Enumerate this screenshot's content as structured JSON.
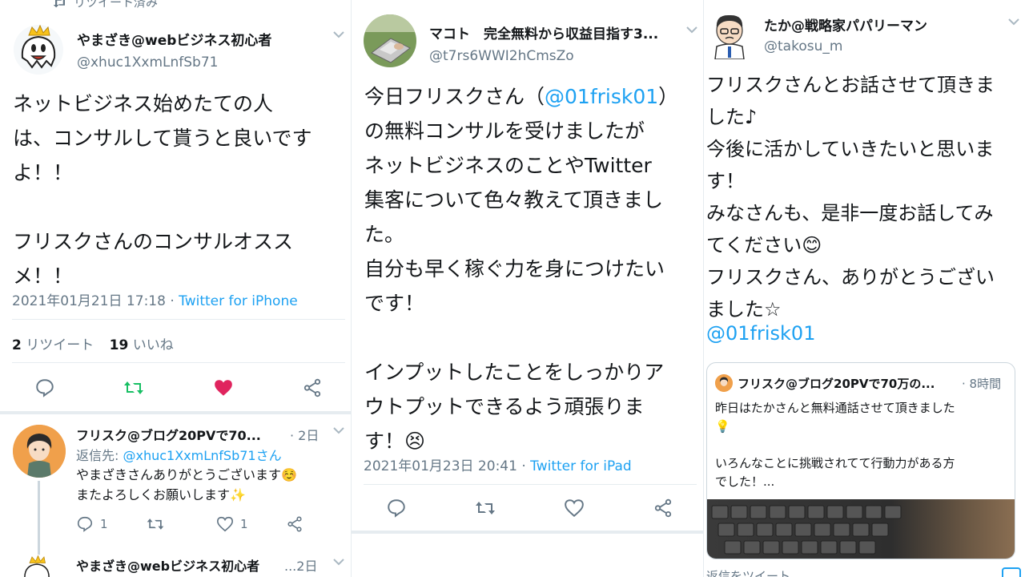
{
  "col1": {
    "retweeted_label": "リツイート済み",
    "author_name": "やまざき@webビジネス初心者",
    "author_handle": "@xhuc1XxmLnfSb71",
    "body": "ネットビジネス始めたての人\nは、コンサルして貰うと良いです\nよ！！\n\nフリスクさんのコンサルオスス\nメ！！",
    "timestamp": "2021年01月21日 17:18 · ",
    "source": "Twitter for iPhone",
    "retweet_count": "2",
    "retweet_label": "リツイート",
    "like_count": "19",
    "like_label": "いいね",
    "reply": {
      "author_name": "フリスク@ブログ20PVで70...",
      "time": "· 2日",
      "reply_to_label": "返信先: ",
      "reply_to_handle": "@xhuc1XxmLnfSb71さん",
      "text": "やまざきさんありがとうございます☺️\nまたよろしくお願いします✨",
      "reply_count": "1",
      "like_count": "1"
    },
    "next_reply": {
      "author_name": "やまざき@webビジネス初心者",
      "time": "...2日"
    }
  },
  "col2": {
    "author_name": "マコト　完全無料から収益目指す3...",
    "author_handle": "@t7rs6WWI2hCmsZo",
    "body_prefix": "今日フリスクさん（",
    "mention": "@01frisk01",
    "body_suffix": "）\nの無料コンサルを受けましたが\nネットビジネスのことやTwitter\n集客について色々教えて頂きまし\nた。\n自分も早く稼ぐ力を身につけたい\nです！\n\nインプットしたことをしっかりア\nウトプットできるよう頑張りま\nす！😣",
    "timestamp": "2021年01月23日 20:41 · ",
    "source": "Twitter for iPad"
  },
  "col3": {
    "author_name": "たか@戦略家パパリーマン",
    "author_handle": "@takosu_m",
    "body": "フリスクさんとお話させて頂きま\nした♪\n今後に活かしていきたいと思いま\nす！\nみなさんも、是非一度お話してみ\nてください😊\nフリスクさん、ありがとうござい\nました☆",
    "mention": "@01frisk01",
    "quote": {
      "author_name": "フリスク@ブログ20PVで70万の...",
      "time": "· 8時間",
      "text": "昨日はたかさんと無料通話させて頂きました\n💡\n\nいろんなことに挑戦されてて行動力がある方\nでした！..."
    },
    "bottom_text": "返信をツイート"
  },
  "colors": {
    "accent": "#1da1f2",
    "retweet_green": "#17bf63",
    "like_red": "#e0245e",
    "muted": "#657786"
  }
}
